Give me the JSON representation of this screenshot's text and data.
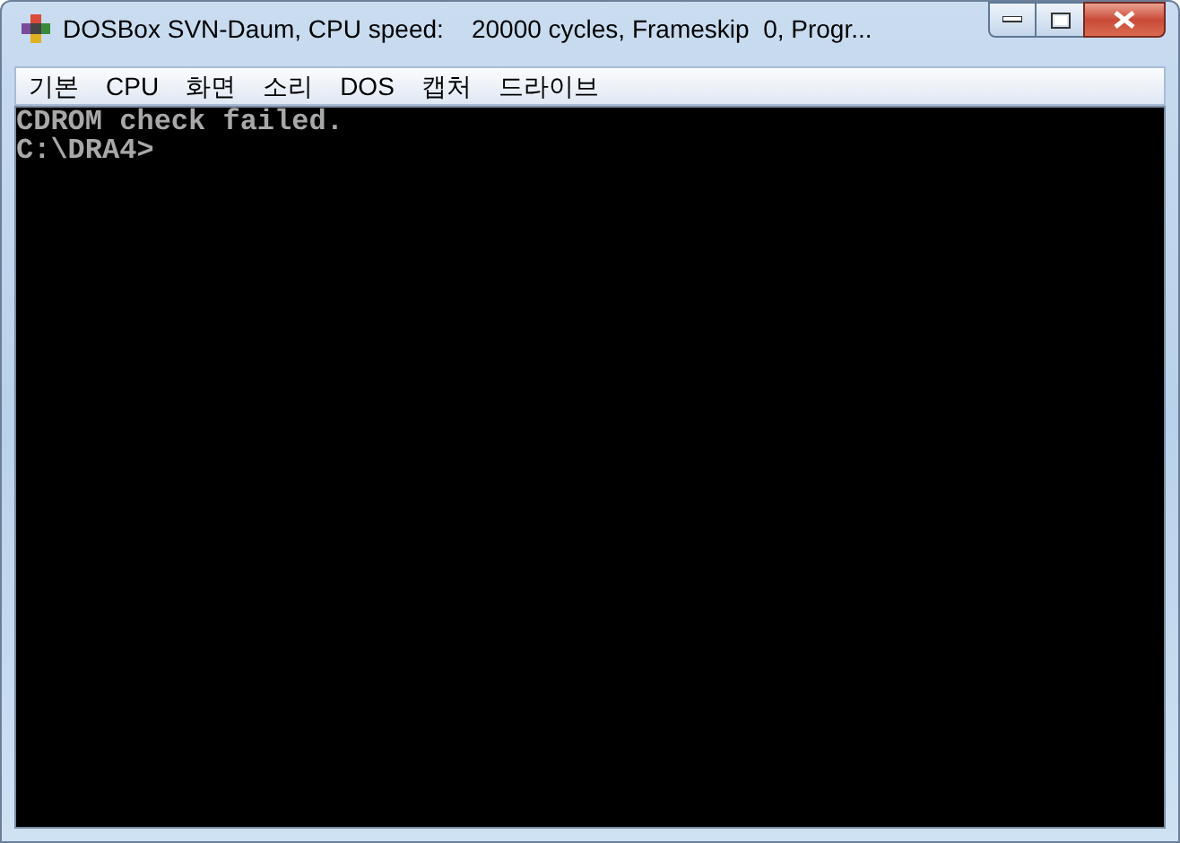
{
  "window": {
    "title": "DOSBox SVN-Daum, CPU speed:    20000 cycles, Frameskip  0, Progr..."
  },
  "menu": [
    {
      "label": "기본"
    },
    {
      "label": "CPU"
    },
    {
      "label": "화면"
    },
    {
      "label": "소리"
    },
    {
      "label": "DOS"
    },
    {
      "label": "캡처"
    },
    {
      "label": "드라이브"
    }
  ],
  "console": {
    "lines": [
      "CDROM check failed.",
      "C:\\DRA4>"
    ]
  }
}
